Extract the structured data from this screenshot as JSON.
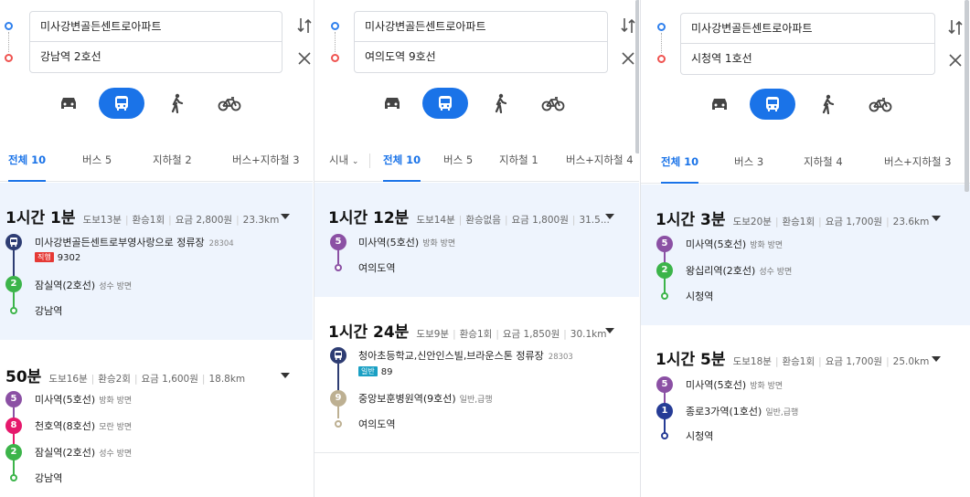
{
  "colors": {
    "accent": "#1a73e8",
    "line2": "#3cb44a",
    "line5": "#8b50a4",
    "line8": "#e6186c",
    "line9": "#bdb092",
    "line1": "#263c96",
    "bus_icon": "#2e3d73",
    "direct_chip": "#e53935",
    "general_chip": "#1aa0c4"
  },
  "modes": [
    "car-icon",
    "bus-icon",
    "walk-icon",
    "bike-icon"
  ],
  "panels": [
    {
      "origin": "미사강변골든센트로아파트",
      "destination": "강남역 2호선",
      "tabs": [
        "전체 10",
        "버스 5",
        "지하철 2",
        "버스+지하철 3"
      ],
      "results": [
        {
          "time": "1시간 1분",
          "walk": "도보13분",
          "transfer": "환승1회",
          "fare": "요금 2,800원",
          "dist": "23.3km",
          "steps": [
            {
              "name": "미사강변골든센트로부영사랑으로 정류장",
              "stop_no": "28304",
              "chip": "직행",
              "bus": "9302"
            },
            {
              "badge": "2",
              "name": "잠실역(2호선)",
              "sub": "성수 방면"
            },
            {
              "name": "강남역"
            }
          ]
        },
        {
          "time": "50분",
          "walk": "도보16분",
          "transfer": "환승2회",
          "fare": "요금 1,600원",
          "dist": "18.8km",
          "steps": [
            {
              "badge": "5",
              "name": "미사역(5호선)",
              "sub": "방화 방면"
            },
            {
              "badge": "8",
              "name": "천호역(8호선)",
              "sub": "모란 방면"
            },
            {
              "badge": "2",
              "name": "잠실역(2호선)",
              "sub": "성수 방면"
            },
            {
              "name": "강남역"
            }
          ]
        }
      ]
    },
    {
      "origin": "미사강변골든센트로아파트",
      "destination": "여의도역 9호선",
      "filter": "시내",
      "tabs": [
        "전체 10",
        "버스 5",
        "지하철 1",
        "버스+지하철 4"
      ],
      "results": [
        {
          "time": "1시간 12분",
          "walk": "도보14분",
          "transfer": "환승없음",
          "fare": "요금 1,800원",
          "dist": "31.5...",
          "steps": [
            {
              "badge": "5",
              "name": "미사역(5호선)",
              "sub": "방화 방면"
            },
            {
              "name": "여의도역"
            }
          ]
        },
        {
          "time": "1시간 24분",
          "walk": "도보9분",
          "transfer": "환승1회",
          "fare": "요금 1,850원",
          "dist": "30.1km",
          "steps": [
            {
              "name": "청아초등학교,신안인스빌,브라운스톤 정류장",
              "stop_no": "28303",
              "chip": "일반",
              "bus": "89"
            },
            {
              "badge": "9",
              "name": "중앙보훈병원역(9호선)",
              "sub": "일반,급행"
            },
            {
              "name": "여의도역"
            }
          ]
        }
      ]
    },
    {
      "origin": "미사강변골든센트로아파트",
      "destination": "시청역 1호선",
      "tabs": [
        "전체 10",
        "버스 3",
        "지하철 4",
        "버스+지하철 3"
      ],
      "results": [
        {
          "time": "1시간 3분",
          "walk": "도보20분",
          "transfer": "환승1회",
          "fare": "요금 1,700원",
          "dist": "23.6km",
          "steps": [
            {
              "badge": "5",
              "name": "미사역(5호선)",
              "sub": "방화 방면"
            },
            {
              "badge": "2",
              "name": "왕십리역(2호선)",
              "sub": "성수 방면"
            },
            {
              "name": "시청역"
            }
          ]
        },
        {
          "time": "1시간 5분",
          "walk": "도보18분",
          "transfer": "환승1회",
          "fare": "요금 1,700원",
          "dist": "25.0km",
          "steps": [
            {
              "badge": "5",
              "name": "미사역(5호선)",
              "sub": "방화 방면"
            },
            {
              "badge": "1",
              "name": "종로3가역(1호선)",
              "sub": "일반,급행"
            },
            {
              "name": "시청역"
            }
          ]
        }
      ]
    }
  ]
}
